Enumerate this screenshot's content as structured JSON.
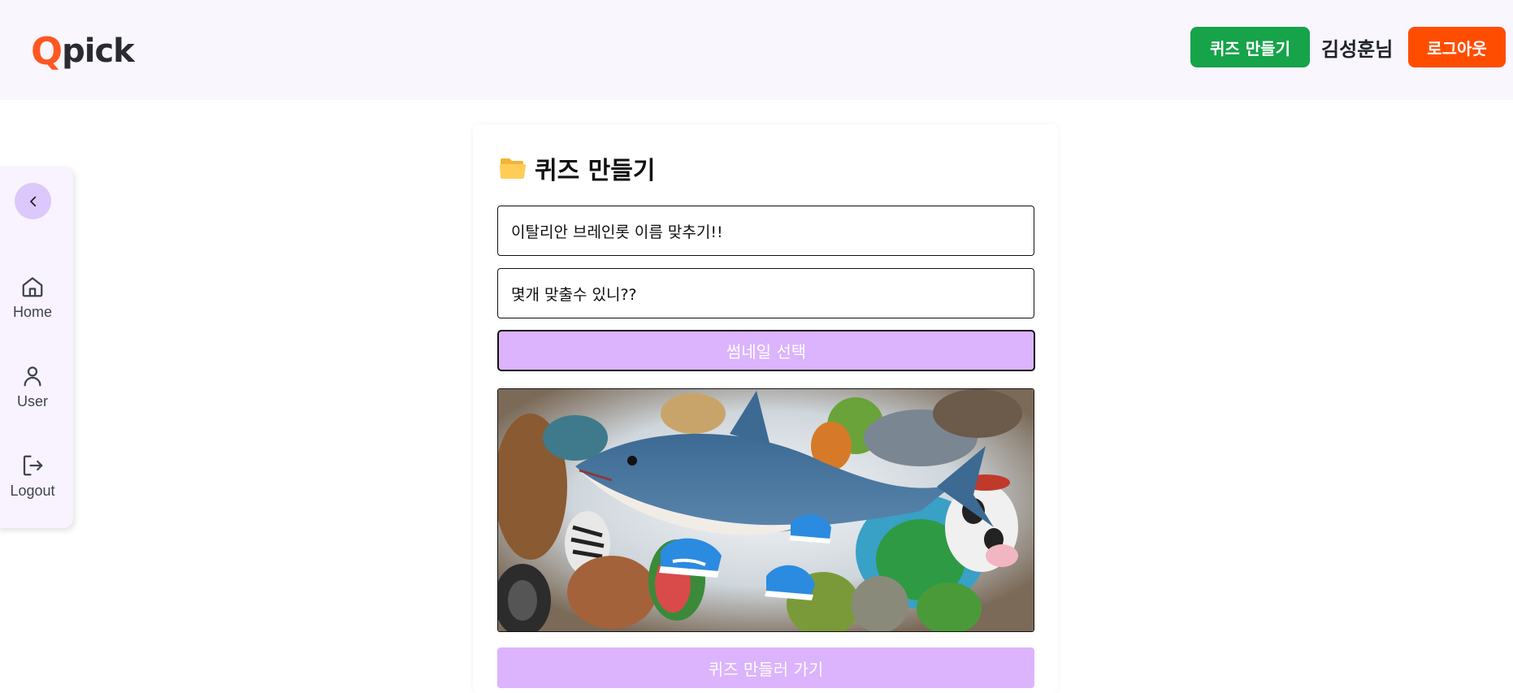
{
  "header": {
    "logo_q": "Q",
    "logo_rest": "pick",
    "make_quiz_label": "퀴즈 만들기",
    "username": "김성훈님",
    "logout_label": "로그아웃"
  },
  "sidebar": {
    "collapse_icon": "chevron-left-icon",
    "items": [
      {
        "label": "Home",
        "icon": "home-icon"
      },
      {
        "label": "User",
        "icon": "user-icon"
      },
      {
        "label": "Logout",
        "icon": "logout-icon"
      }
    ]
  },
  "form": {
    "title_icon": "folder-icon",
    "title": "퀴즈 만들기",
    "quiz_title_value": "이탈리안 브레인롯 이름 맞추기!!",
    "quiz_desc_value": "몇개 맞출수 있니??",
    "thumbnail_button_label": "썸네일 선택",
    "submit_label": "퀴즈 만들러 가기"
  },
  "colors": {
    "header_bg": "#f9f6fe",
    "logo_accent": "#ff5722",
    "make_button": "#16a34a",
    "logout_button": "#ff4d00",
    "purple_button": "#dcb3fd",
    "sidebar_bg": "#f8f3fe"
  }
}
